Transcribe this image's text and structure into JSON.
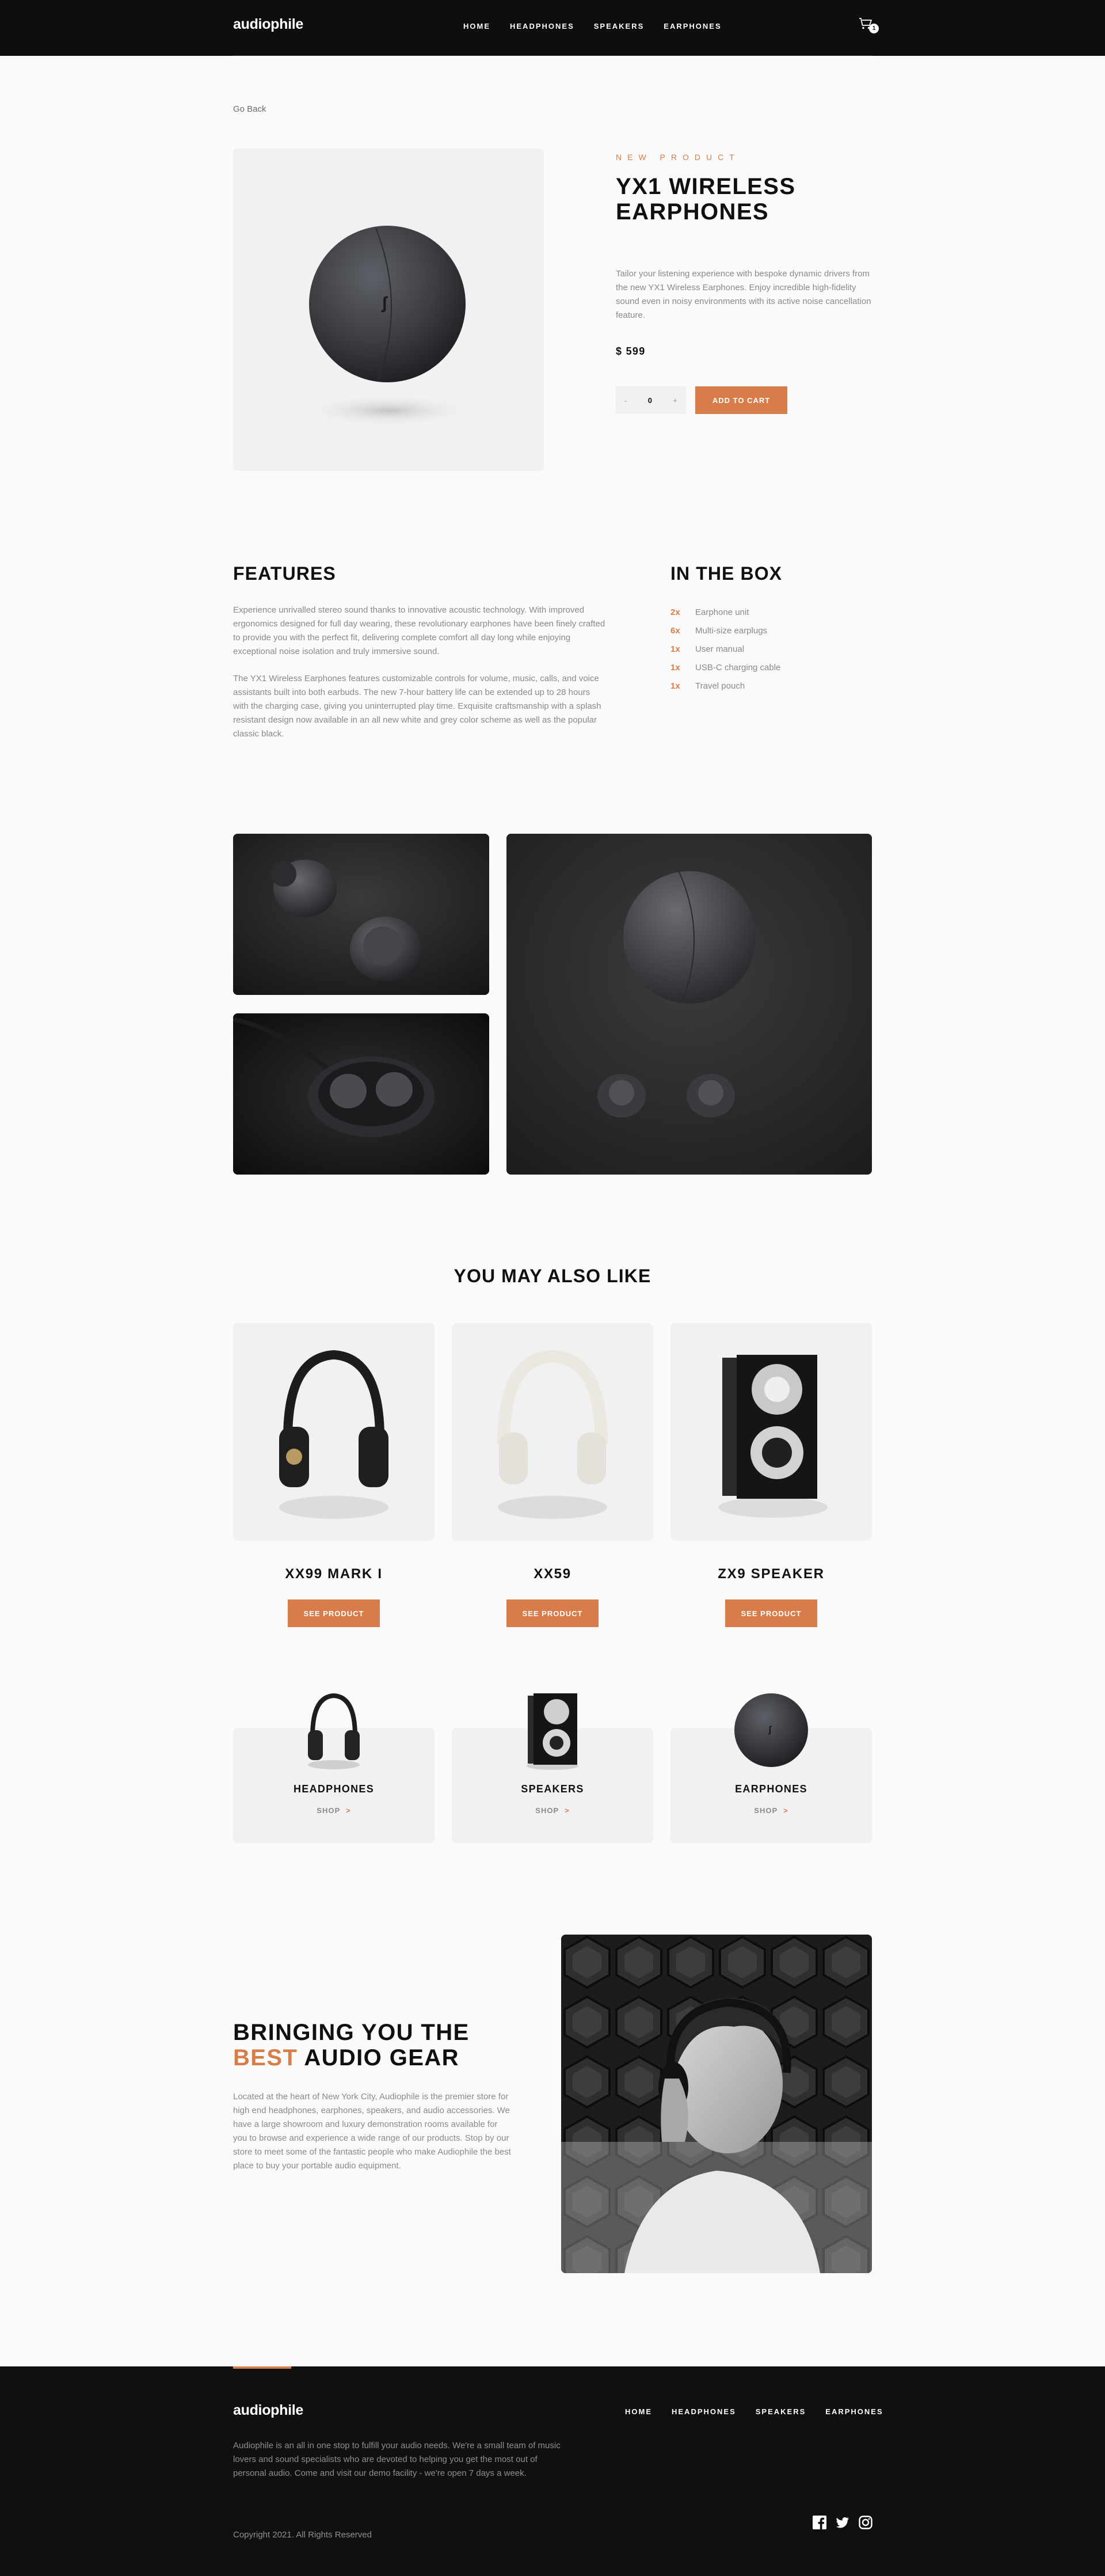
{
  "brand": {
    "logo": "audiophile",
    "accent": "#d87d4a"
  },
  "nav": [
    "HOME",
    "HEADPHONES",
    "SPEAKERS",
    "EARPHONES"
  ],
  "cart": {
    "count": "1"
  },
  "go_back": "Go Back",
  "product": {
    "overline": "NEW PRODUCT",
    "title": "YX1 WIRELESS EARPHONES",
    "description": "Tailor your listening experience with bespoke dynamic drivers from the new YX1 Wireless Earphones. Enjoy incredible high-fidelity sound even in noisy environments with its active noise cancellation feature.",
    "price": "$ 599",
    "quantity": "0",
    "minus": "-",
    "plus": "+",
    "add_to_cart": "ADD TO CART"
  },
  "features": {
    "title": "FEATURES",
    "p1": "Experience unrivalled stereo sound thanks to innovative acoustic technology. With improved ergonomics designed for full day wearing, these revolutionary earphones have been finely crafted to provide you with the perfect fit, delivering complete comfort all day long while enjoying exceptional noise isolation and truly immersive sound.",
    "p2": "The YX1 Wireless Earphones features customizable controls for volume, music, calls, and voice assistants built into both earbuds. The new 7-hour battery life can be extended up to 28 hours with the charging case, giving you uninterrupted play time. Exquisite craftsmanship with a splash resistant design now available in an all new white and grey color scheme as well as the popular classic black."
  },
  "in_the_box": {
    "title": "IN THE BOX",
    "items": [
      {
        "qty": "2x",
        "name": "Earphone unit"
      },
      {
        "qty": "6x",
        "name": "Multi-size earplugs"
      },
      {
        "qty": "1x",
        "name": "User manual"
      },
      {
        "qty": "1x",
        "name": "USB-C charging cable"
      },
      {
        "qty": "1x",
        "name": "Travel pouch"
      }
    ]
  },
  "also_like": {
    "title": "YOU MAY ALSO LIKE",
    "items": [
      {
        "name": "XX99 MARK I",
        "button": "SEE PRODUCT"
      },
      {
        "name": "XX59",
        "button": "SEE PRODUCT"
      },
      {
        "name": "ZX9 SPEAKER",
        "button": "SEE PRODUCT"
      }
    ]
  },
  "categories": [
    {
      "name": "HEADPHONES",
      "shop": "SHOP",
      "chevron": ">"
    },
    {
      "name": "SPEAKERS",
      "shop": "SHOP",
      "chevron": ">"
    },
    {
      "name": "EARPHONES",
      "shop": "SHOP",
      "chevron": ">"
    }
  ],
  "about": {
    "title_before": "BRINGING YOU THE",
    "title_accent": "BEST",
    "title_after": "AUDIO GEAR",
    "description": "Located at the heart of New York City, Audiophile is the premier store for high end headphones, earphones, speakers, and audio accessories. We have a large showroom and luxury demonstration rooms available for you to browse and experience a wide range of our products. Stop by our store to meet some of the fantastic people who make Audiophile the best place to buy your portable audio equipment."
  },
  "footer": {
    "description": "Audiophile is an all in one stop to fulfill your audio needs. We're a small team of music lovers and sound specialists who are devoted to helping you get the most out of personal audio. Come and visit our demo facility - we're open 7 days a week.",
    "copyright": "Copyright 2021. All Rights Reserved",
    "social": [
      "facebook-icon",
      "twitter-icon",
      "instagram-icon"
    ]
  }
}
